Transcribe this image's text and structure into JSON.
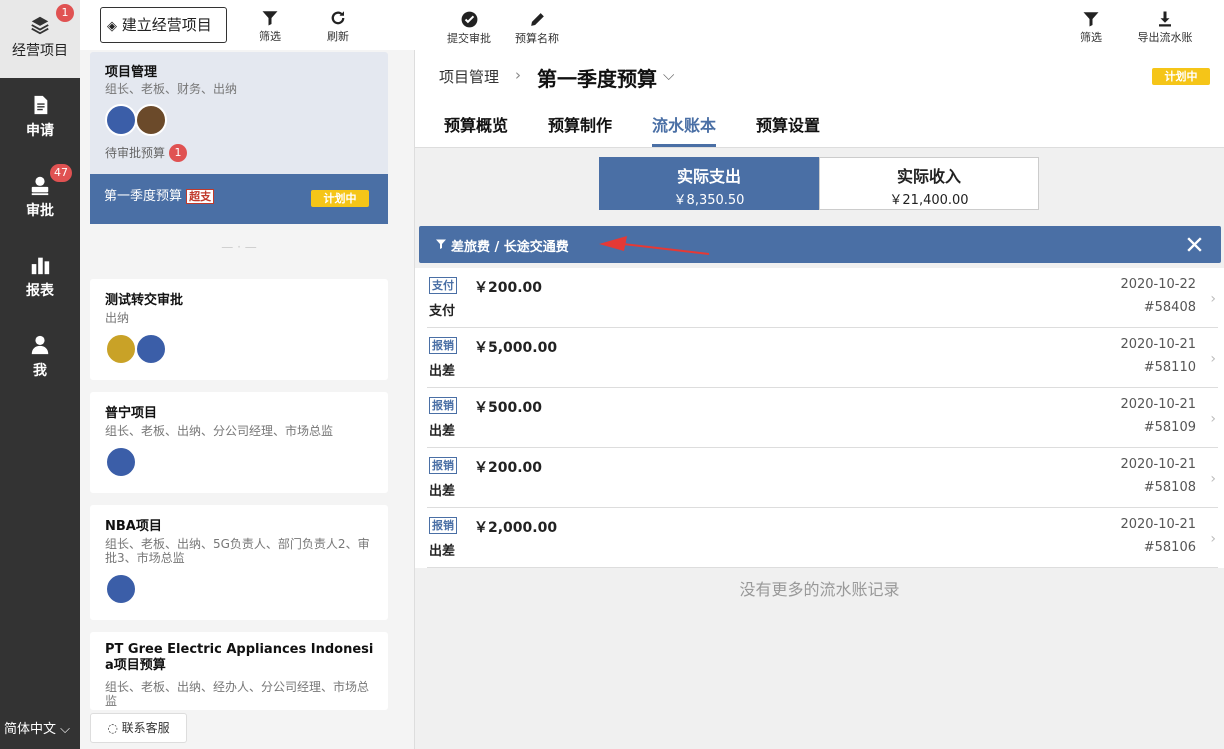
{
  "nav": {
    "items": [
      {
        "label": "经营项目",
        "icon": "layers-icon",
        "badge": "1"
      },
      {
        "label": "申请",
        "icon": "document-icon",
        "badge": ""
      },
      {
        "label": "审批",
        "icon": "user-stamp-icon",
        "badge": "47"
      },
      {
        "label": "报表",
        "icon": "bar-chart-icon",
        "badge": ""
      },
      {
        "label": "我",
        "icon": "person-icon",
        "badge": ""
      }
    ],
    "language": "简体中文"
  },
  "list_toolbar": {
    "new_project": "建立经营项目",
    "filter": "筛选",
    "refresh": "刷新"
  },
  "projects": [
    {
      "title": "项目管理",
      "roles": "组长、老板、财务、出纳",
      "pending": "待审批预算",
      "pending_count": "1",
      "selected_budget": "第一季度预算",
      "over_tag": "超支",
      "status": "计划中"
    },
    {
      "title": "测试转交审批",
      "roles": "出纳"
    },
    {
      "title": "普宁项目",
      "roles": "组长、老板、出纳、分公司经理、市场总监"
    },
    {
      "title": "NBA项目",
      "roles": "组长、老板、出纳、5G负责人、部门负责人2、审批3、市场总监"
    },
    {
      "title": "PT Gree Electric Appliances Indonesia项目预算",
      "roles": "组长、老板、出纳、经办人、分公司经理、市场总监"
    }
  ],
  "divider": "— · —",
  "contact": "联系客服",
  "main_toolbar": {
    "submit": "提交审批",
    "rename": "预算名称",
    "filter": "筛选",
    "export": "导出流水账"
  },
  "breadcrumb": {
    "parent": "项目管理",
    "title": "第一季度预算",
    "status": "计划中"
  },
  "tabs": [
    "预算概览",
    "预算制作",
    "流水账本",
    "预算设置"
  ],
  "segments": [
    {
      "label": "实际支出",
      "amount": "￥8,350.50"
    },
    {
      "label": "实际收入",
      "amount": "￥21,400.00"
    }
  ],
  "filter_text": "差旅费 / 长途交通费",
  "records": [
    {
      "tag": "支付",
      "amount": "￥200.00",
      "category": "支付",
      "date": "2020-10-22",
      "id": "#58408"
    },
    {
      "tag": "报销",
      "amount": "￥5,000.00",
      "category": "出差",
      "date": "2020-10-21",
      "id": "#58110"
    },
    {
      "tag": "报销",
      "amount": "￥500.00",
      "category": "出差",
      "date": "2020-10-21",
      "id": "#58109"
    },
    {
      "tag": "报销",
      "amount": "￥200.00",
      "category": "出差",
      "date": "2020-10-21",
      "id": "#58108"
    },
    {
      "tag": "报销",
      "amount": "￥2,000.00",
      "category": "出差",
      "date": "2020-10-21",
      "id": "#58106"
    }
  ],
  "no_more": "没有更多的流水账记录",
  "colors": {
    "accent": "#4a6fa5",
    "warning": "#f5c518",
    "danger": "#e05252",
    "nav": "#333333"
  }
}
